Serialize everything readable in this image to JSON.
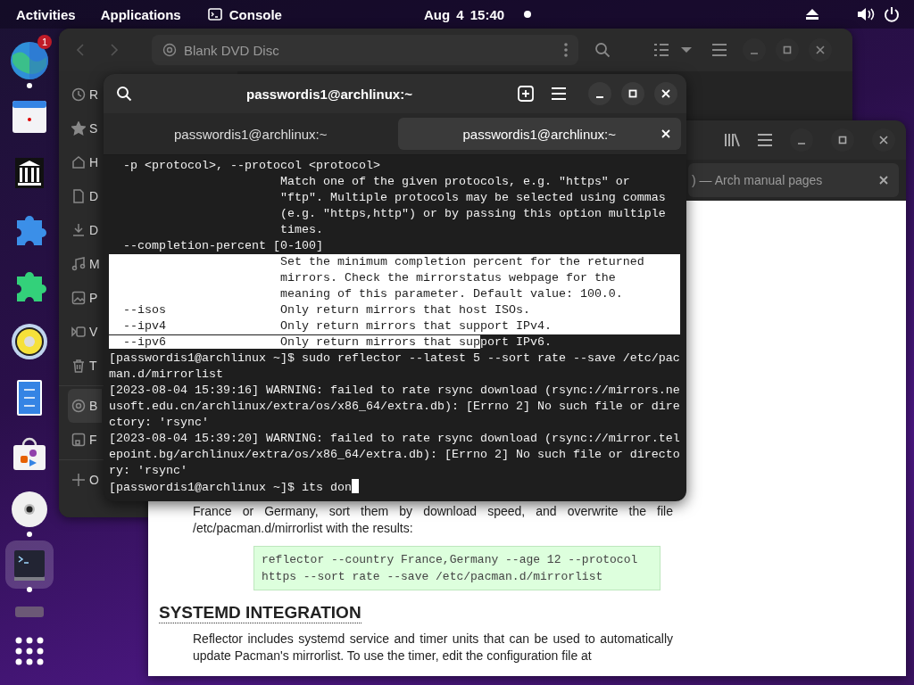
{
  "top_bar": {
    "activities": "Activities",
    "applications": "Applications",
    "app_name": "Console",
    "clock": "Aug 4  15:40"
  },
  "dock": [
    {
      "kind": "browser",
      "running": true,
      "badge": "1",
      "selected": false
    },
    {
      "kind": "calendar",
      "running": false,
      "selected": false
    },
    {
      "kind": "library",
      "running": false,
      "selected": false
    },
    {
      "kind": "puzzle-blue",
      "running": false,
      "selected": false
    },
    {
      "kind": "puzzle-green",
      "running": false,
      "selected": false
    },
    {
      "kind": "speaker",
      "running": false,
      "selected": false
    },
    {
      "kind": "document",
      "running": false,
      "selected": false
    },
    {
      "kind": "store",
      "running": false,
      "selected": false
    },
    {
      "kind": "disc",
      "running": true,
      "selected": false
    },
    {
      "kind": "terminal",
      "running": true,
      "selected": true
    },
    {
      "kind": "bar",
      "running": false,
      "selected": false
    },
    {
      "kind": "grid",
      "running": false,
      "selected": false
    }
  ],
  "files_window": {
    "location": "Blank DVD Disc",
    "sidebar": [
      {
        "items": [
          {
            "kind": "recent",
            "label": "R",
            "selected": false
          },
          {
            "kind": "starred",
            "label": "S",
            "selected": false
          },
          {
            "kind": "home",
            "label": "H",
            "selected": false
          },
          {
            "kind": "documents",
            "label": "D",
            "selected": false
          },
          {
            "kind": "downloads",
            "label": "D",
            "selected": false
          },
          {
            "kind": "music",
            "label": "M",
            "selected": false
          },
          {
            "kind": "pictures",
            "label": "P",
            "selected": false
          },
          {
            "kind": "videos",
            "label": "V",
            "selected": false
          },
          {
            "kind": "trash",
            "label": "T",
            "selected": false
          }
        ]
      },
      {
        "items": [
          {
            "kind": "disc",
            "label": "B",
            "selected": true
          },
          {
            "kind": "drive",
            "label": "F",
            "selected": false
          }
        ]
      },
      {
        "items": [
          {
            "kind": "other",
            "label": "O",
            "selected": false
          }
        ]
      }
    ]
  },
  "browser_window": {
    "tab": ") — Arch manual pages",
    "intro": "France or Germany, sort them by download speed, and overwrite the file /etc/pacman.d/mirrorlist with the results:",
    "code": [
      "reflector --country France,Germany --age 12 --protocol",
      "https --sort rate --save /etc/pacman.d/mirrorlist"
    ],
    "heading": "SYSTEMD INTEGRATION",
    "paragraph": "Reflector includes systemd service and timer units that can be used to automatically update Pacman's mirrorlist. To use the timer, edit the configuration file at"
  },
  "terminal_window": {
    "title": "passwordis1@archlinux:~",
    "tabs": [
      {
        "label": "passwordis1@archlinux:~",
        "selected": false
      },
      {
        "label": "passwordis1@archlinux:~",
        "selected": true
      }
    ],
    "lines": [
      {
        "segments": [
          {
            "text": "  -p <protocol>, --protocol <protocol>",
            "selected": false
          }
        ]
      },
      {
        "segments": [
          {
            "text": "                        Match one of the given protocols, e.g. \"https\" or",
            "selected": false
          }
        ]
      },
      {
        "segments": [
          {
            "text": "                        \"ftp\". Multiple protocols may be selected using commas",
            "selected": false
          }
        ]
      },
      {
        "segments": [
          {
            "text": "                        (e.g. \"https,http\") or by passing this option multiple",
            "selected": false
          }
        ]
      },
      {
        "segments": [
          {
            "text": "                        times.",
            "selected": false
          }
        ]
      },
      {
        "segments": [
          {
            "text": "  --completion-percent [0-100]",
            "selected": false
          }
        ]
      },
      {
        "segments": [
          {
            "text": "                        Set the minimum completion percent for the returned",
            "selected": true
          }
        ]
      },
      {
        "segments": [
          {
            "text": "                        mirrors. Check the mirrorstatus webpage for the",
            "selected": true
          }
        ]
      },
      {
        "segments": [
          {
            "text": "                        meaning of this parameter. Default value: 100.0.",
            "selected": true
          }
        ]
      },
      {
        "segments": [
          {
            "text": "  --isos                Only return mirrors that host ISOs.",
            "selected": true
          }
        ]
      },
      {
        "segments": [
          {
            "text": "  --ipv4                Only return mirrors that support IPv4.",
            "selected": true
          }
        ]
      },
      {
        "segments": [
          {
            "text": "  --ipv6                Only return mirrors that sup",
            "selected": true
          },
          {
            "text": "port IPv6.",
            "selected": false
          }
        ]
      },
      {
        "segments": [
          {
            "text": "[passwordis1@archlinux ~]$ sudo reflector --latest 5 --sort rate --save /etc/pac",
            "selected": false
          }
        ]
      },
      {
        "segments": [
          {
            "text": "man.d/mirrorlist",
            "selected": false
          }
        ]
      },
      {
        "segments": [
          {
            "text": "[2023-08-04 15:39:16] WARNING: failed to rate rsync download (rsync://mirrors.ne",
            "selected": false
          }
        ]
      },
      {
        "segments": [
          {
            "text": "usoft.edu.cn/archlinux/extra/os/x86_64/extra.db): [Errno 2] No such file or dire",
            "selected": false
          }
        ]
      },
      {
        "segments": [
          {
            "text": "ctory: 'rsync'",
            "selected": false
          }
        ]
      },
      {
        "segments": [
          {
            "text": "[2023-08-04 15:39:20] WARNING: failed to rate rsync download (rsync://mirror.tel",
            "selected": false
          }
        ]
      },
      {
        "segments": [
          {
            "text": "epoint.bg/archlinux/extra/os/x86_64/extra.db): [Errno 2] No such file or directo",
            "selected": false
          }
        ]
      },
      {
        "segments": [
          {
            "text": "ry: 'rsync'",
            "selected": false
          }
        ]
      },
      {
        "segments": [
          {
            "text": "[passwordis1@archlinux ~]$ its don",
            "selected": false
          }
        ],
        "cursor": true
      }
    ]
  }
}
